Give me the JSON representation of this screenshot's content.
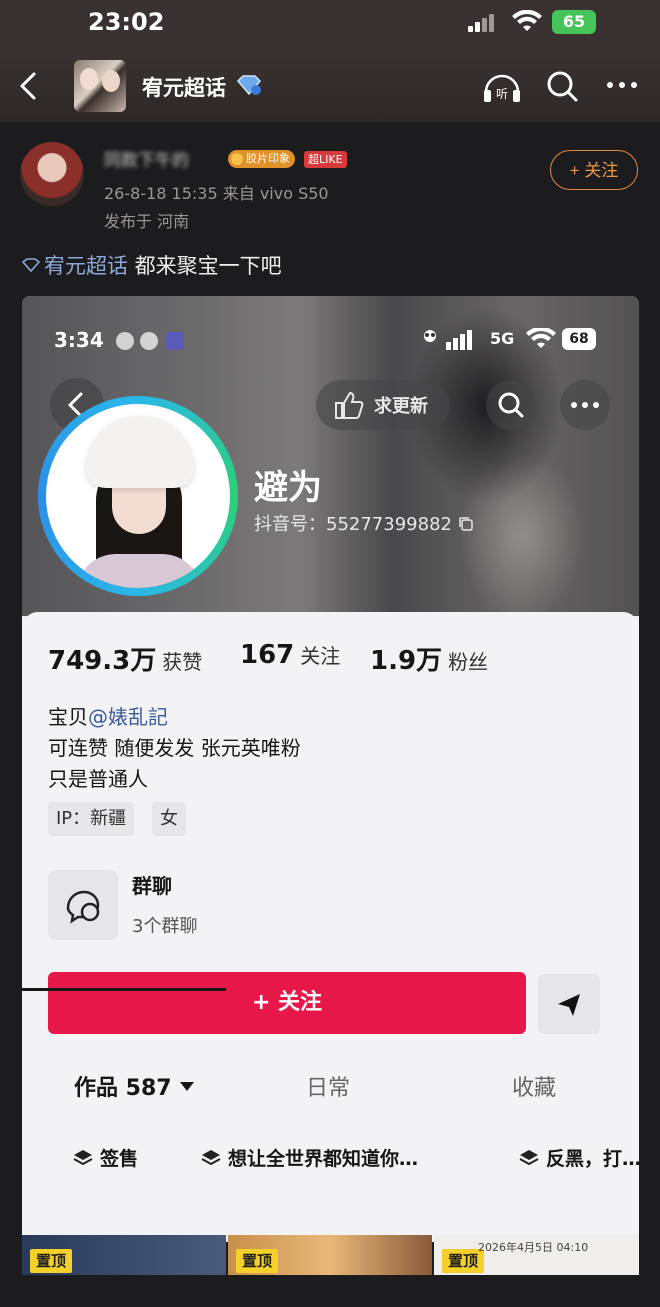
{
  "status_bar": {
    "time": "23:02",
    "battery": "65"
  },
  "nav": {
    "title": "宥元超话"
  },
  "post": {
    "author_name": "同款下午的",
    "badge_photo": "胶片印象",
    "badge_like": "超LIKE",
    "time_device": "26-8-18 15:35  来自 vivo S50",
    "location": "发布于 河南",
    "follow_label": "+ 关注",
    "topic": "宥元超话",
    "text": " 都来聚宝一下吧"
  },
  "embedded": {
    "status_time": "3:34",
    "network": "5G",
    "battery": "68",
    "more_update": "求更新",
    "profile_name": "避为",
    "douyin_id": "抖音号：55277399882",
    "stats": [
      {
        "value": "749.3万",
        "label": "获赞"
      },
      {
        "value": "167",
        "label": "关注"
      },
      {
        "value": "1.9万",
        "label": "粉丝"
      }
    ],
    "bio_prefix": "宝贝",
    "bio_mention": "@婊乱記",
    "bio_line2": "可连赞 随便发发 张元英唯粉",
    "bio_line3": "只是普通人",
    "tags": [
      "IP：新疆",
      "女"
    ],
    "group_title": "群聊",
    "group_sub": "3个群聊",
    "follow_label": "+ 关注",
    "tabs": [
      "作品 587",
      "日常",
      "收藏"
    ],
    "collections": [
      "签售",
      "想让全世界都知道你…",
      "反黑，打…"
    ],
    "pinned_label": "置顶",
    "thumb_date": "2026年4月5日 04:10"
  }
}
